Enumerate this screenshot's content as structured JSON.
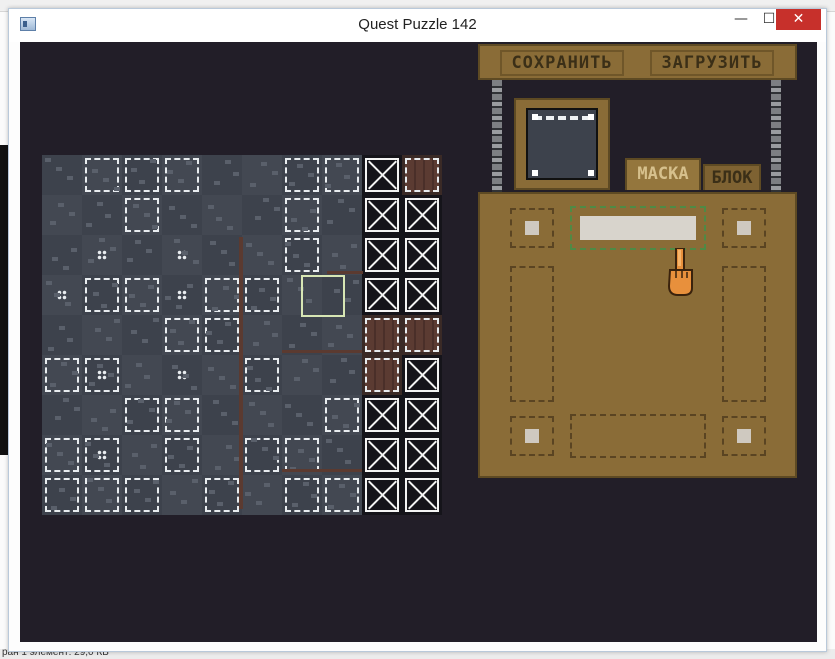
{
  "window": {
    "title": "Quest Puzzle 142",
    "min_symbol": "—",
    "max_symbol": "☐",
    "close_symbol": "✕"
  },
  "status_bar": {
    "text": "ран 1 элемент: 29,0 КБ"
  },
  "panel": {
    "save_label": "СОХРАНИТЬ",
    "load_label": "ЗАГРУЗИТЬ",
    "tab_mask_label": "МАСКА",
    "tab_block_label": "БЛОК"
  },
  "colors": {
    "canvas_bg": "#221e28",
    "panel_bg": "#8a6c37",
    "stone": "#3d424c",
    "highlight": "#d7e6b4",
    "selected_slot": "#4f8a45"
  },
  "icons": [
    "app-icon",
    "hand-pointer-icon",
    "crate-icon"
  ]
}
